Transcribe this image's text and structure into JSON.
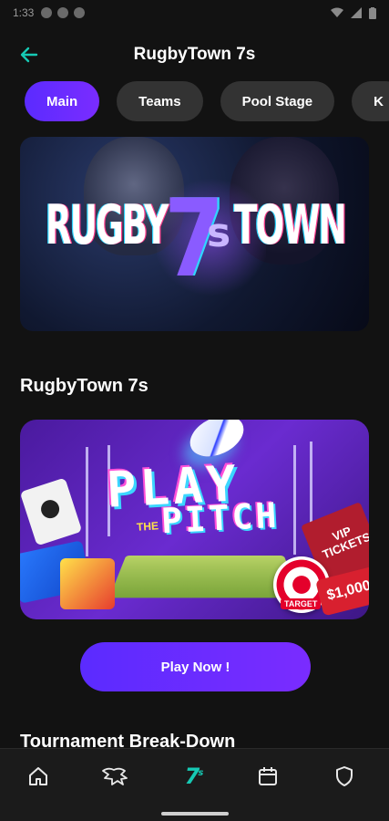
{
  "status_bar": {
    "time": "1:33",
    "icons": [
      "notification-icon",
      "clipboard-icon",
      "shield-icon"
    ],
    "right_icons": [
      "wifi-icon",
      "signal-icon",
      "battery-icon"
    ]
  },
  "header": {
    "title": "RugbyTown 7s",
    "back_icon": "arrow-left-icon"
  },
  "tabs": [
    {
      "label": "Main",
      "active": true
    },
    {
      "label": "Teams",
      "active": false
    },
    {
      "label": "Pool Stage",
      "active": false
    },
    {
      "label": "K",
      "active": false
    }
  ],
  "hero": {
    "word_left": "RUGBY",
    "seven": "7",
    "s": "s",
    "word_right": "TOWN"
  },
  "section": {
    "title": "RugbyTown 7s"
  },
  "promo": {
    "play": "PLAY",
    "the": "THE",
    "pitch": "PITCH",
    "vip": "VIP\nTICKETS",
    "target": "TARGET",
    "prize": "$1,000"
  },
  "cta": {
    "label": "Play Now !"
  },
  "next_section": {
    "title": "Tournament Break-Down"
  },
  "bottom_nav": {
    "items": [
      {
        "icon": "home-icon",
        "active": false
      },
      {
        "icon": "horse-icon",
        "active": false
      },
      {
        "icon": "sevens-logo-icon",
        "label": "7",
        "sup": "s",
        "active": true
      },
      {
        "icon": "calendar-icon",
        "active": false
      },
      {
        "icon": "shield-icon",
        "active": false
      }
    ]
  },
  "colors": {
    "background": "#121212",
    "accent": "#6a2cff",
    "teal": "#16c9b4",
    "tab_inactive": "#333333"
  }
}
